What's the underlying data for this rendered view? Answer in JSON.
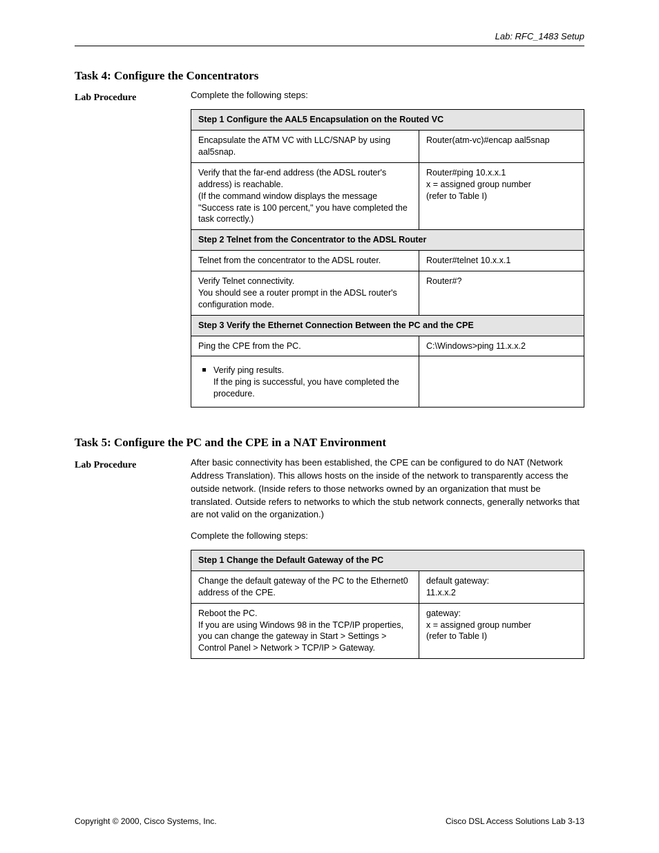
{
  "header": {
    "right_text": "Lab: RFC_1483 Setup"
  },
  "section1": {
    "title": "Task 4: Configure the Concentrators",
    "side_label": "Lab Procedure",
    "intro": "Complete the following steps:",
    "table": {
      "groups": [
        {
          "header": "Step 1 Configure the AAL5 Encapsulation on the Routed VC",
          "rows": [
            {
              "action": "Encapsulate the ATM VC with LLC/SNAP by using aal5snap.",
              "command": "Router(atm-vc)#encap aal5snap"
            },
            {
              "action": "Verify that the far-end address (the ADSL router's address) is reachable.<br>(If the command window displays the message \"Success rate is 100 percent,\" you have completed the task correctly.)",
              "command": "Router#ping 10.x.x.1<br>x = assigned group number<br>(refer to Table I)"
            }
          ]
        },
        {
          "header": "Step 2 Telnet from the Concentrator to the ADSL Router",
          "rows": [
            {
              "action": "Telnet from the concentrator to the ADSL router.",
              "command": "Router#telnet 10.x.x.1"
            },
            {
              "action": "Verify Telnet connectivity.<br>You should see a router prompt in the ADSL router's configuration mode.",
              "command": "Router#?"
            }
          ]
        },
        {
          "header": "Step 3 Verify the Ethernet Connection Between the PC and the CPE",
          "rows": [
            {
              "action": "Ping the CPE from the PC.",
              "command": "C:\\Windows>ping 11.x.x.2"
            },
            {
              "action": "<ul class='sq'><li>Verify ping results.<br>If the ping is successful, you have completed the procedure.</li></ul>",
              "command": ""
            }
          ]
        }
      ]
    }
  },
  "section2": {
    "title": "Task 5: Configure the PC and the CPE in a NAT Environment",
    "side_label": "Lab Procedure",
    "body": "After basic connectivity has been established, the CPE can be configured to do NAT (Network Address Translation). This allows hosts on the inside of the network to transparently access the outside network. (Inside refers to those networks owned by an organization that must be translated. Outside refers to networks to which the stub network connects, generally networks that are not valid on the organization.)",
    "intro": "Complete the following steps:",
    "table": {
      "groups": [
        {
          "header": "Step 1 Change the Default Gateway of the PC",
          "rows": [
            {
              "action": "Change the default gateway of the PC to the Ethernet0 address of the CPE.",
              "command": "default gateway:<br>11.x.x.2"
            },
            {
              "action": "Reboot the PC.<br>If you are using Windows 98 in the TCP/IP properties, you can change the gateway in Start > Settings > Control Panel > Network > TCP/IP > Gateway.",
              "command": "gateway:<br>x = assigned group number<br>(refer to Table I)"
            }
          ]
        }
      ]
    }
  },
  "footer": {
    "left": "Copyright © 2000, Cisco Systems, Inc.",
    "right": "Cisco DSL Access Solutions Lab 3-13"
  }
}
